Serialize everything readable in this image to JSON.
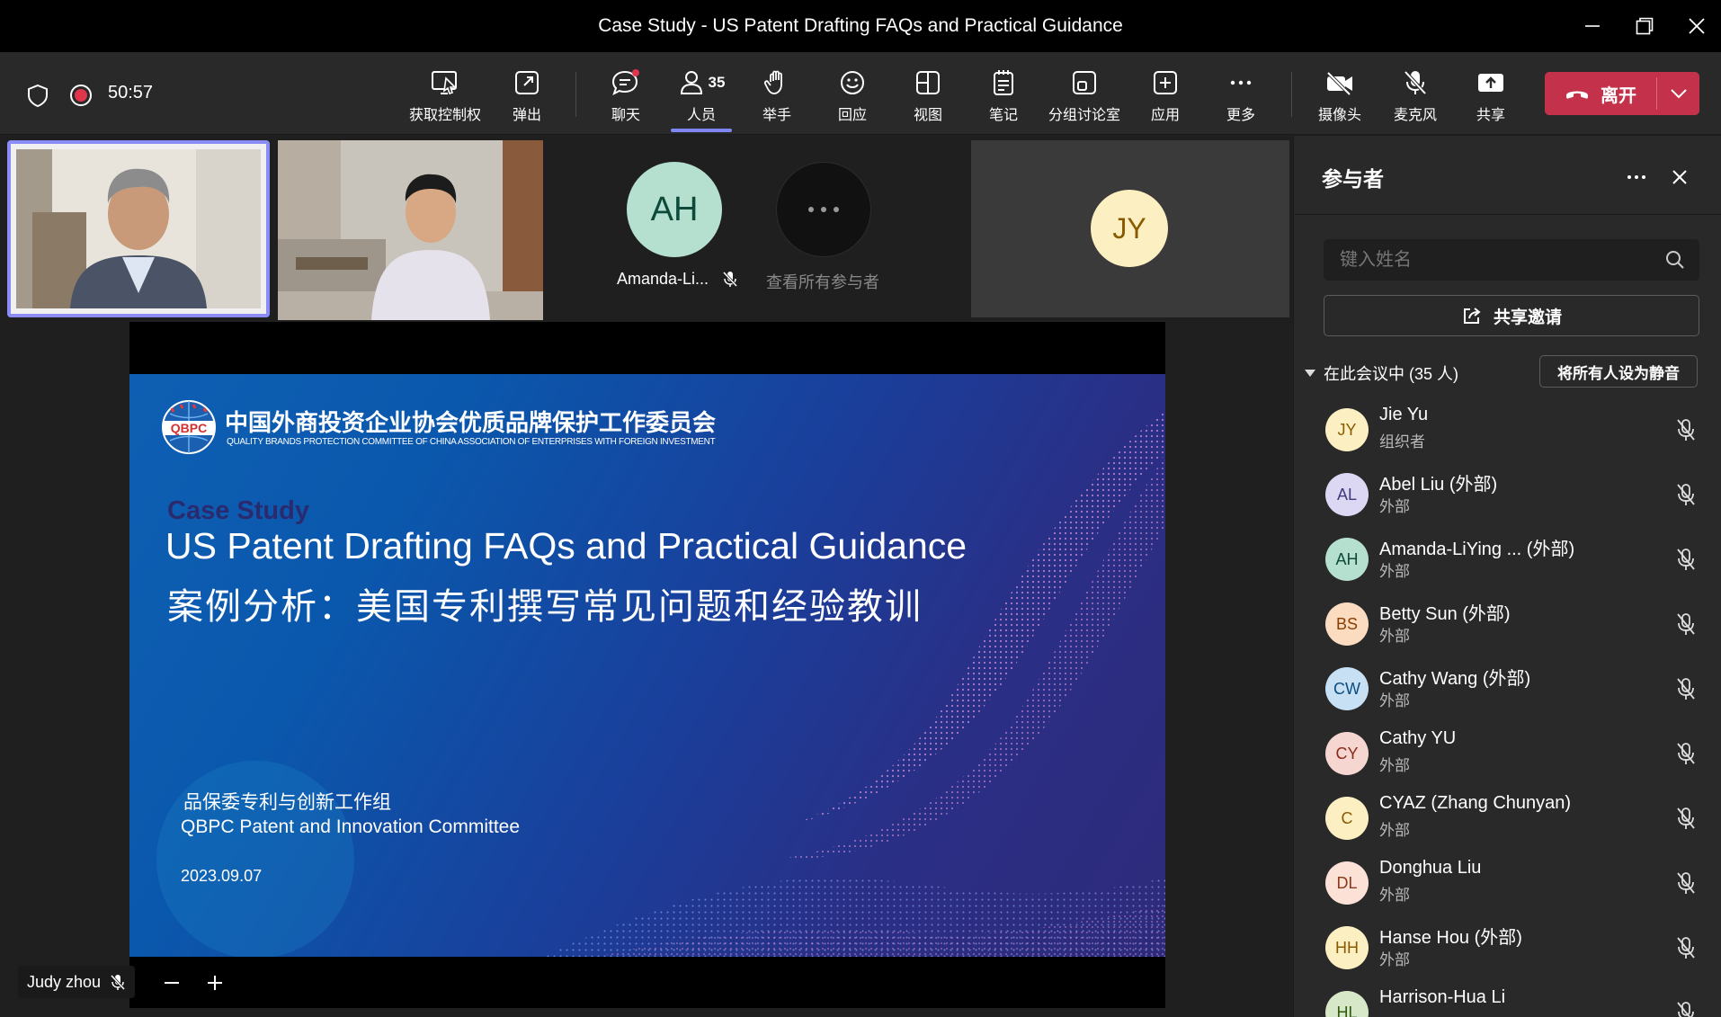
{
  "window": {
    "title": "Case Study - US Patent Drafting FAQs and Practical Guidance"
  },
  "toolbar": {
    "timer": "50:57",
    "request_control": "获取控制权",
    "popout": "弹出",
    "chat": "聊天",
    "people": "人员",
    "people_count": "35",
    "raise_hand": "举手",
    "react": "回应",
    "view": "视图",
    "notes": "笔记",
    "breakout": "分组讨论室",
    "apps": "应用",
    "more": "更多",
    "camera": "摄像头",
    "mic": "麦克风",
    "share": "共享",
    "leave": "离开"
  },
  "colors": {
    "leave": "#c4314b",
    "active_tab": "#7f85f5",
    "recording": "#e0364c"
  },
  "stage": {
    "tile_ah_initials": "AH",
    "tile_ah_name": "Amanda-Li...",
    "view_all": "查看所有参与者",
    "tile_jy_initials": "JY",
    "presenter_name": "Judy zhou"
  },
  "slide": {
    "org_name_cn": "中国外商投资企业协会优质品牌保护工作委员会",
    "org_name_en": "QUALITY BRANDS PROTECTION COMMITTEE OF CHINA ASSOCIATION OF ENTERPRISES WITH FOREIGN INVESTMENT",
    "logo_text": "QBPC",
    "kicker": "Case Study",
    "title_en": "US Patent Drafting FAQs and Practical Guidance",
    "title_cn": "案例分析：美国专利撰写常见问题和经验教训",
    "group_cn": "品保委专利与创新工作组",
    "group_en": "QBPC Patent and Innovation Committee",
    "date": "2023.09.07"
  },
  "panel": {
    "title": "参与者",
    "search_placeholder": "键入姓名",
    "share_invite": "共享邀请",
    "in_meeting": "在此会议中 (35 人)",
    "mute_all": "将所有人设为静音",
    "participants": [
      {
        "initials": "JY",
        "name": "Jie Yu",
        "role": "组织者",
        "bg": "#fcefc2",
        "fg": "#8a5a00"
      },
      {
        "initials": "AL",
        "name": "Abel Liu (外部)",
        "role": "外部",
        "bg": "#dcd8f3",
        "fg": "#3f3a7a"
      },
      {
        "initials": "AH",
        "name": "Amanda-LiYing ...  (外部)",
        "role": "外部",
        "bg": "#b5dfcf",
        "fg": "#0e4a3a"
      },
      {
        "initials": "BS",
        "name": "Betty Sun (外部)",
        "role": "外部",
        "bg": "#fcdcc0",
        "fg": "#8a3d00"
      },
      {
        "initials": "CW",
        "name": "Cathy Wang (外部)",
        "role": "外部",
        "bg": "#c7e0f4",
        "fg": "#0b4d80"
      },
      {
        "initials": "CY",
        "name": "Cathy YU",
        "role": "外部",
        "bg": "#f5d6d0",
        "fg": "#8a2b1a"
      },
      {
        "initials": "C",
        "name": "CYAZ (Zhang Chunyan)",
        "role": "外部",
        "bg": "#fcefc2",
        "fg": "#8a5a00"
      },
      {
        "initials": "DL",
        "name": "Donghua Liu",
        "role": "外部",
        "bg": "#fbe1d6",
        "fg": "#8a3a1a"
      },
      {
        "initials": "HH",
        "name": "Hanse Hou (外部)",
        "role": "外部",
        "bg": "#fcefc2",
        "fg": "#8a5a00"
      },
      {
        "initials": "HL",
        "name": "Harrison-Hua Li",
        "role": "",
        "bg": "#d6e8c8",
        "fg": "#2f5a10"
      }
    ]
  }
}
